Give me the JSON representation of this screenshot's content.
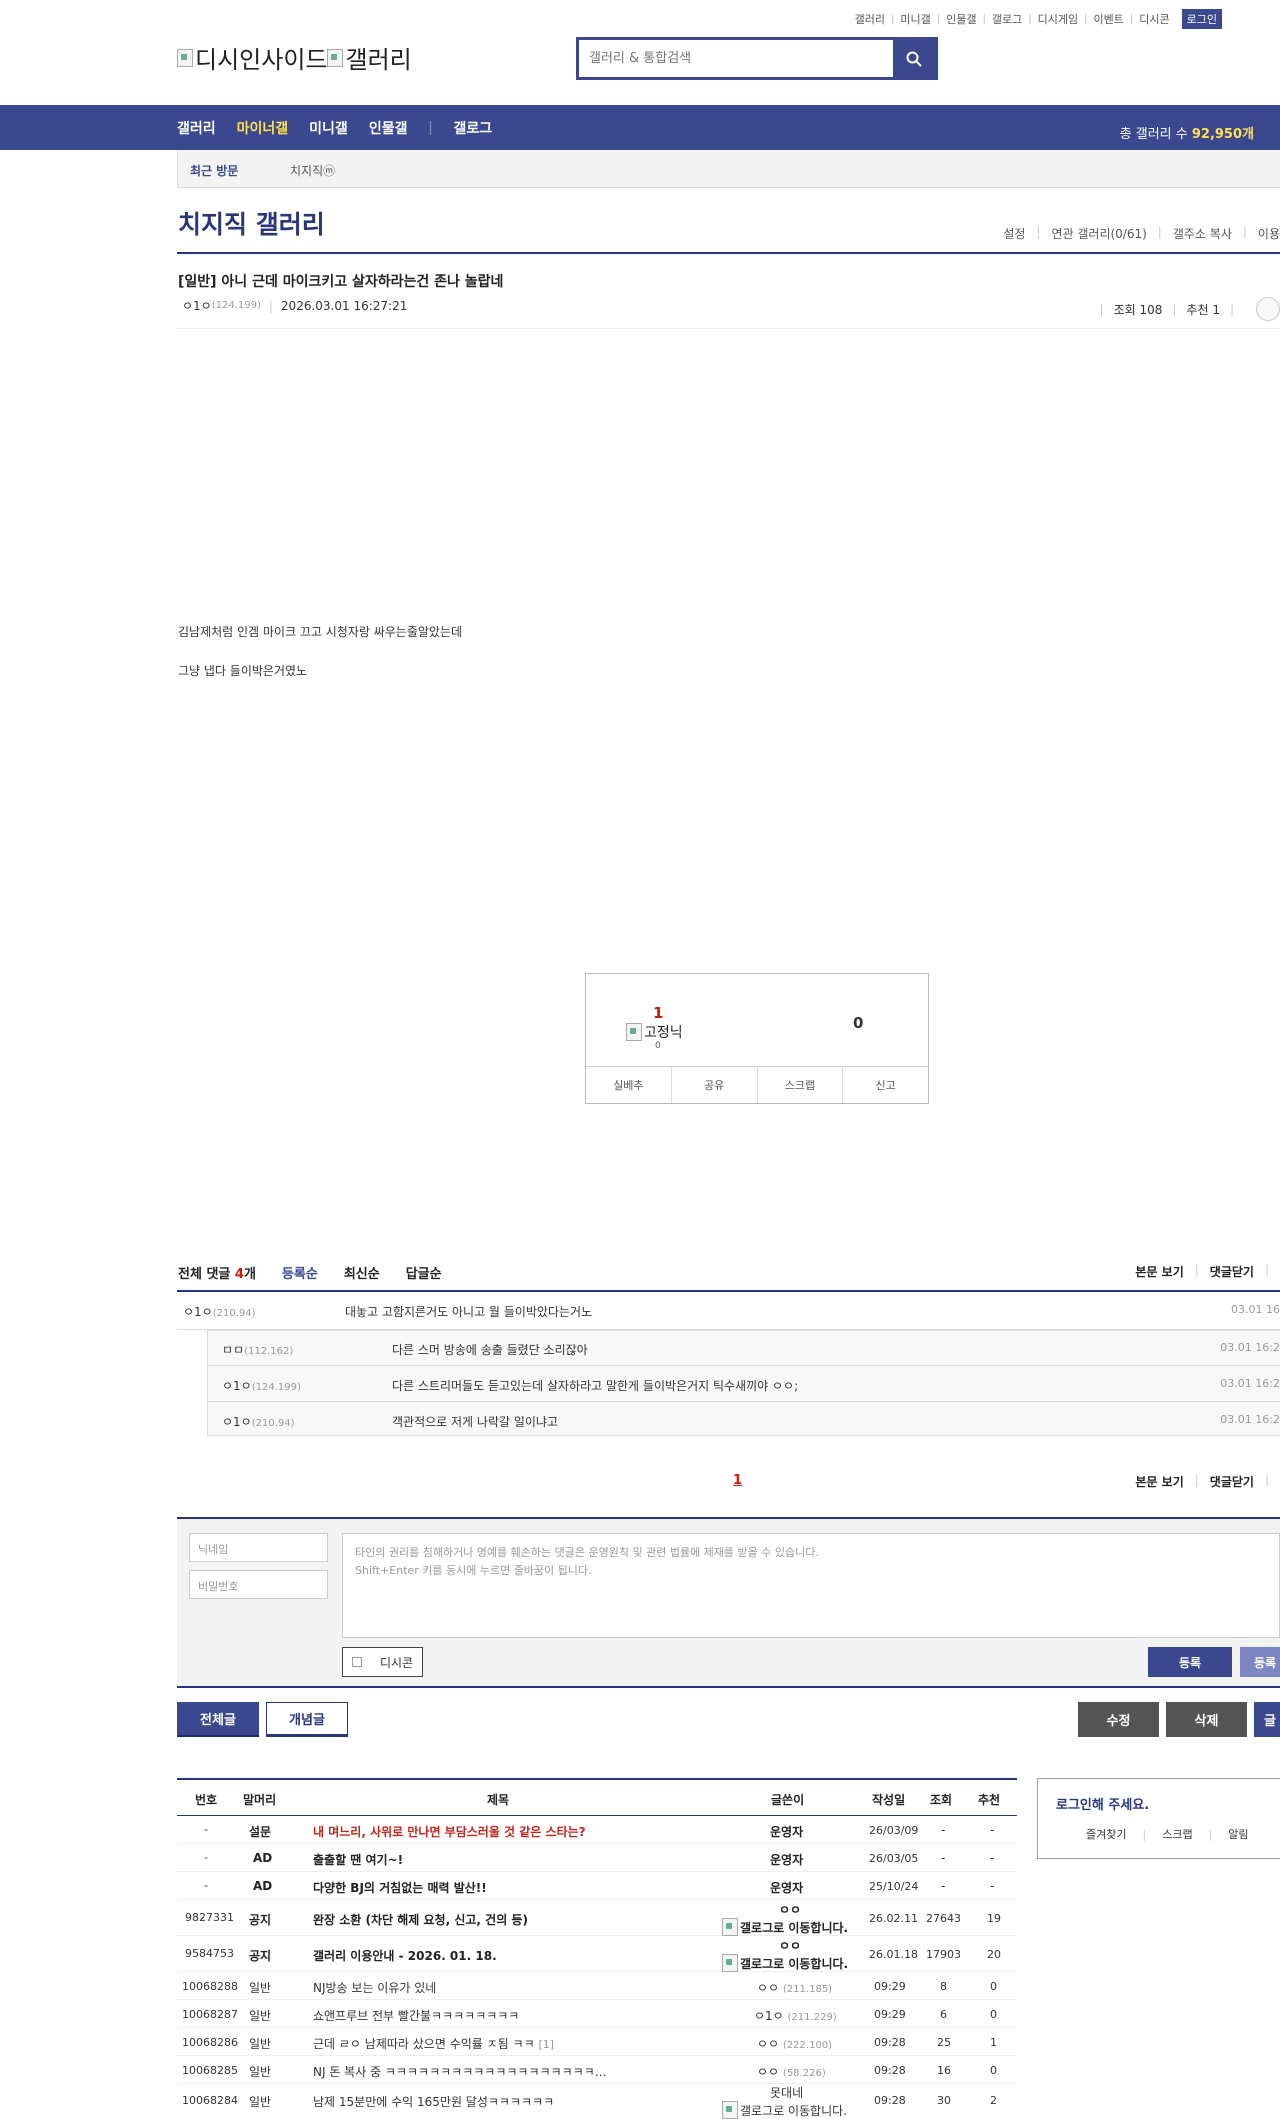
{
  "top_links": [
    "갤러리",
    "미니갤",
    "인물갤",
    "갤로그",
    "디시게임",
    "이벤트",
    "디시콘"
  ],
  "login_label": "로그인",
  "logo": {
    "text1": "디시인사이드",
    "text2": "갤러리"
  },
  "search": {
    "placeholder": "갤러리 & 통합검색"
  },
  "gnb": {
    "items": [
      "갤러리",
      "마이너갤",
      "미니갤",
      "인물갤"
    ],
    "galog": "갤로그",
    "count_label": "총 갤러리 수",
    "count_value": "92,950개"
  },
  "recent": {
    "label": "최근 방문",
    "item": "치지직ⓜ"
  },
  "gallery": {
    "title": "치지직 갤러리",
    "tools": [
      "설정",
      "연관 갤러리(0/61)",
      "갤주소 복사",
      "이용"
    ]
  },
  "post": {
    "title": "[일반] 아니 근데 마이크키고 살자하라는건 존나 놀랍네",
    "author": "ㅇ1ㅇ",
    "author_ip": "(124.199)",
    "date": "2026.03.01 16:27:21",
    "views": "조회 108",
    "recommends": "추천 1",
    "body": [
      "김남제처럼 인겜 마이크 끄고 시청자랑 싸우는줄알았는데",
      "그냥 냅다 들이박은거였노"
    ]
  },
  "vote": {
    "up": "1",
    "fixed_nick": "고정닉",
    "fixed_nick_count": "0",
    "down": "0",
    "buttons": [
      "실베추",
      "공유",
      "스크랩",
      "신고"
    ]
  },
  "comments": {
    "total_label": "전체 댓글",
    "count": "4",
    "unit": "개",
    "sorts": [
      "등록순",
      "최신순",
      "답글순"
    ],
    "right": [
      "본문 보기",
      "댓글닫기"
    ],
    "items": [
      {
        "nick": "ㅇ1ㅇ",
        "ip": "(210.94)",
        "text": "대놓고 고함지른거도 아니고 뭘 들이박았다는거노",
        "date": "03.01 16"
      },
      {
        "nick": "ㅁㅁ",
        "ip": "(112.162)",
        "text": "다른 스머 방송에 송출 들렸단 소리잖아",
        "date": "03.01 16:2"
      },
      {
        "nick": "ㅇ1ㅇ",
        "ip": "(124.199)",
        "text": "다른 스트리머들도 듣고있는데 살자하라고 말한게 들이박은거지 틱수새끼야 ㅇㅇ;",
        "date": "03.01 16:2"
      },
      {
        "nick": "ㅇ1ㅇ",
        "ip": "(210.94)",
        "text": "객관적으로 저게 나락갈 일이냐고",
        "date": "03.01 16:2"
      }
    ],
    "page": "1"
  },
  "write": {
    "nick_placeholder": "닉네임",
    "pw_placeholder": "비밀번호",
    "notice1": "타인의 권리를 침해하거나 명예를 훼손하는 댓글은 운영원칙 및 관련 법률에 제재를 받을 수 있습니다.",
    "notice2": "Shift+Enter 키를 동시에 누르면 줄바꿈이 됩니다.",
    "dccon": "디시콘",
    "register": "등록",
    "register2": "등록"
  },
  "list_tabs": {
    "all": "전체글",
    "concept": "개념글",
    "edit": "수정",
    "delete": "삭제",
    "write": "글"
  },
  "board": {
    "headers": [
      "번호",
      "말머리",
      "제목",
      "글쓴이",
      "작성일",
      "조회",
      "추천"
    ],
    "rows": [
      {
        "no": "-",
        "head": "설문",
        "title": "내 며느리, 사위로 만나면 부담스러울 것 같은 스타는?",
        "writer": "운영자",
        "date": "26/03/09",
        "views": "-",
        "rec": "-"
      },
      {
        "no": "-",
        "head": "AD",
        "title": "출출할 땐 여기~!",
        "writer": "운영자",
        "date": "26/03/05",
        "views": "-",
        "rec": "-"
      },
      {
        "no": "-",
        "head": "AD",
        "title": "다양한 BJ의 거침없는 매력 발산!!",
        "writer": "운영자",
        "date": "25/10/24",
        "views": "-",
        "rec": "-"
      },
      {
        "no": "9827331",
        "head": "공지",
        "title": "완장 소환 (차단 해제 요청, 신고, 건의 등)",
        "writer": "ㅇㅇ",
        "writer2": "갤로그로 이동합니다.",
        "date": "26.02.11",
        "views": "27643",
        "rec": "19"
      },
      {
        "no": "9584753",
        "head": "공지",
        "title": "갤러리 이용안내 - 2026. 01. 18.",
        "writer": "ㅇㅇ",
        "writer2": "갤로그로 이동합니다.",
        "date": "26.01.18",
        "views": "17903",
        "rec": "20"
      },
      {
        "no": "10068288",
        "head": "일반",
        "title": "NJ방송 보는 이유가 있네",
        "writer": "ㅇㅇ",
        "ip": "(211.185)",
        "date": "09:29",
        "views": "8",
        "rec": "0"
      },
      {
        "no": "10068287",
        "head": "일반",
        "title": "쇼앤프루브 전부 빨간불ㅋㅋㅋㅋㅋㅋㅋㅋ",
        "writer": "ㅇ1ㅇ",
        "ip": "(211.229)",
        "date": "09:29",
        "views": "6",
        "rec": "0"
      },
      {
        "no": "10068286",
        "head": "일반",
        "title": "근데 ㄹㅇ 남제따라 샀으면 수익률 ㅈ됨 ㅋㅋ",
        "reply": "[1]",
        "writer": "ㅇㅇ",
        "ip": "(222.100)",
        "date": "09:28",
        "views": "25",
        "rec": "1"
      },
      {
        "no": "10068285",
        "head": "일반",
        "title": "NJ 돈 복사 중 ㅋㅋㅋㅋㅋㅋㅋㅋㅋㅋㅋㅋㅋㅋㅋㅋㅋㅋㅋ…",
        "writer": "ㅇㅇ",
        "ip": "(58.226)",
        "date": "09:28",
        "views": "16",
        "rec": "0"
      },
      {
        "no": "10068284",
        "head": "일반",
        "title": "남제 15분만에 수익 165만원 달성ㅋㅋㅋㅋㅋㅋ",
        "writer": "못대네",
        "writer2": "갤로그로 이동합니다.",
        "date": "09:28",
        "views": "30",
        "rec": "2"
      }
    ]
  },
  "loginbox": {
    "title": "로그인해 주세요.",
    "links": [
      "즐겨찾기",
      "스크랩",
      "알림"
    ]
  }
}
